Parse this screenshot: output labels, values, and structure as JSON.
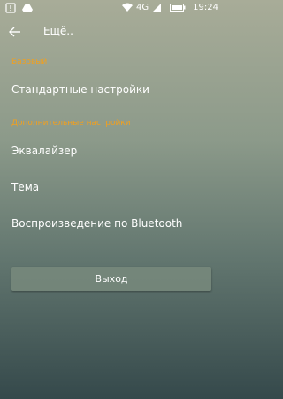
{
  "status_bar": {
    "network": "4G",
    "time": "19:24",
    "icons": [
      "alert-icon",
      "drive-icon",
      "wifi-icon",
      "signal-icon",
      "battery-icon"
    ]
  },
  "app_bar": {
    "title": "Ещё..",
    "back_icon": "arrow-left-icon"
  },
  "sections": {
    "basic": {
      "header": "Базовый",
      "items": [
        "Стандартные настройки"
      ]
    },
    "advanced": {
      "header": "Дополнительные настройки",
      "items": [
        "Эквалайзер",
        "Тема",
        "Воспроизведение по Bluetooth"
      ]
    }
  },
  "exit_button": "Выход",
  "colors": {
    "accent": "#f0a020",
    "button": "#788a7c"
  }
}
